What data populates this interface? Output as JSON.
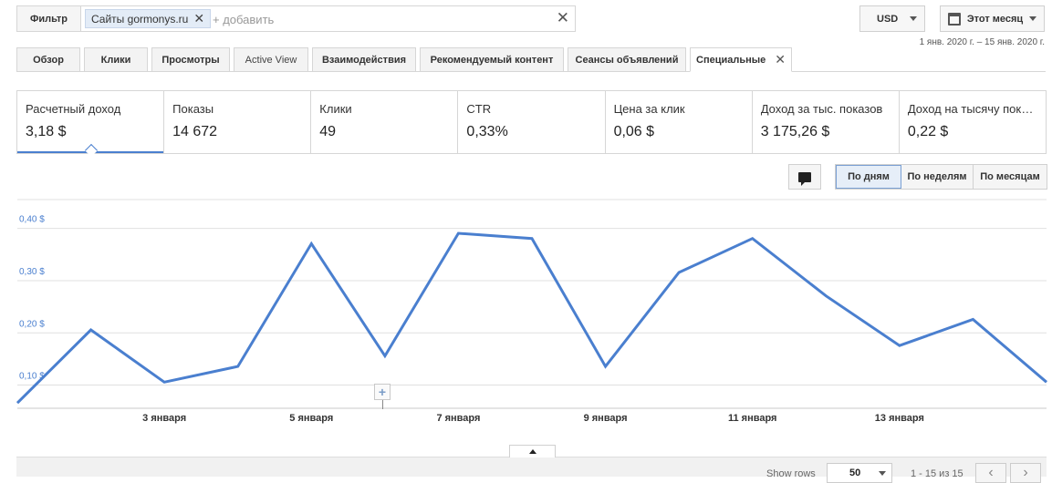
{
  "filter": {
    "button_label": "Фильтр",
    "chip_prefix": "Сайты",
    "chip_value": "gormonys.ru",
    "add_placeholder": "+ добавить"
  },
  "currency": "USD",
  "period": "Этот месяц",
  "date_range": "1 янв. 2020 г. – 15 янв. 2020 г.",
  "tabs": [
    {
      "label": "Обзор"
    },
    {
      "label": "Клики"
    },
    {
      "label": "Просмотры"
    },
    {
      "label": "Active View"
    },
    {
      "label": "Взаимодействия"
    },
    {
      "label": "Рекомендуемый контент"
    },
    {
      "label": "Сеансы объявлений"
    },
    {
      "label": "Специальные"
    }
  ],
  "metrics": [
    {
      "label": "Расчетный доход",
      "value": "3,18 $"
    },
    {
      "label": "Показы",
      "value": "14 672"
    },
    {
      "label": "Клики",
      "value": "49"
    },
    {
      "label": "CTR",
      "value": "0,33%"
    },
    {
      "label": "Цена за клик",
      "value": "0,06 $"
    },
    {
      "label": "Доход за тыс. показов",
      "value": "3 175,26 $"
    },
    {
      "label": "Доход на тысячу показов",
      "value": "0,22 $"
    }
  ],
  "granularity": {
    "day": "По дням",
    "week": "По неделям",
    "month": "По месяцам"
  },
  "chart_data": {
    "type": "line",
    "x": [
      "1 января",
      "2 января",
      "3 января",
      "4 января",
      "5 января",
      "6 января",
      "7 января",
      "8 января",
      "9 января",
      "10 января",
      "11 января",
      "12 января",
      "13 января",
      "14 января",
      "15 января"
    ],
    "xticks": [
      "3 января",
      "5 января",
      "7 января",
      "9 января",
      "11 января",
      "13 января"
    ],
    "yticks": [
      "0,10 $",
      "0,20 $",
      "0,30 $",
      "0,40 $"
    ],
    "ylim": [
      0.05,
      0.45
    ],
    "series": [
      {
        "values": [
          0.05,
          0.19,
          0.09,
          0.12,
          0.355,
          0.14,
          0.375,
          0.365,
          0.12,
          0.3,
          0.365,
          0.255,
          0.16,
          0.21,
          0.09
        ]
      }
    ],
    "color": "#4a7fcf",
    "grid": true
  },
  "footer": {
    "show_rows_label": "Show rows",
    "rows_value": "50",
    "pager_text": "1 - 15 из 15"
  }
}
